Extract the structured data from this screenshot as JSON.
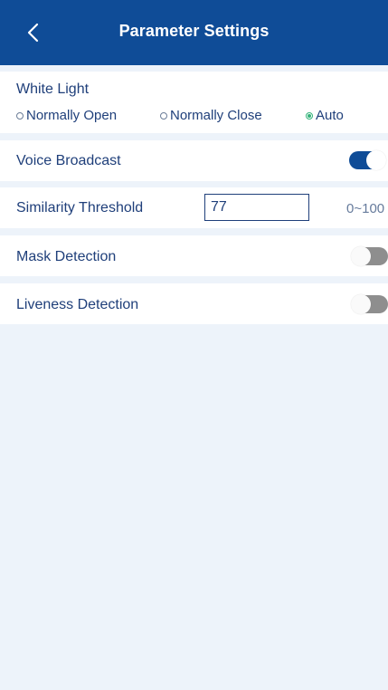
{
  "header": {
    "title": "Parameter Settings",
    "back_icon": "chevron-left-icon"
  },
  "white_light": {
    "label": "White Light",
    "options": [
      {
        "label": "Normally Open",
        "selected": false
      },
      {
        "label": "Normally Close",
        "selected": false
      },
      {
        "label": "Auto",
        "selected": true
      }
    ]
  },
  "voice_broadcast": {
    "label": "Voice Broadcast",
    "enabled": true
  },
  "similarity_threshold": {
    "label": "Similarity Threshold",
    "value": "77",
    "range": "0~100"
  },
  "mask_detection": {
    "label": "Mask Detection",
    "enabled": false
  },
  "liveness_detection": {
    "label": "Liveness Detection",
    "enabled": false
  },
  "colors": {
    "header": "#0f4c97",
    "background": "#edf3fa",
    "text": "#1f3f7a",
    "selected_radio": "#34b37a",
    "toggle_on": "#0f4c97",
    "toggle_off": "#8e8e8e"
  }
}
